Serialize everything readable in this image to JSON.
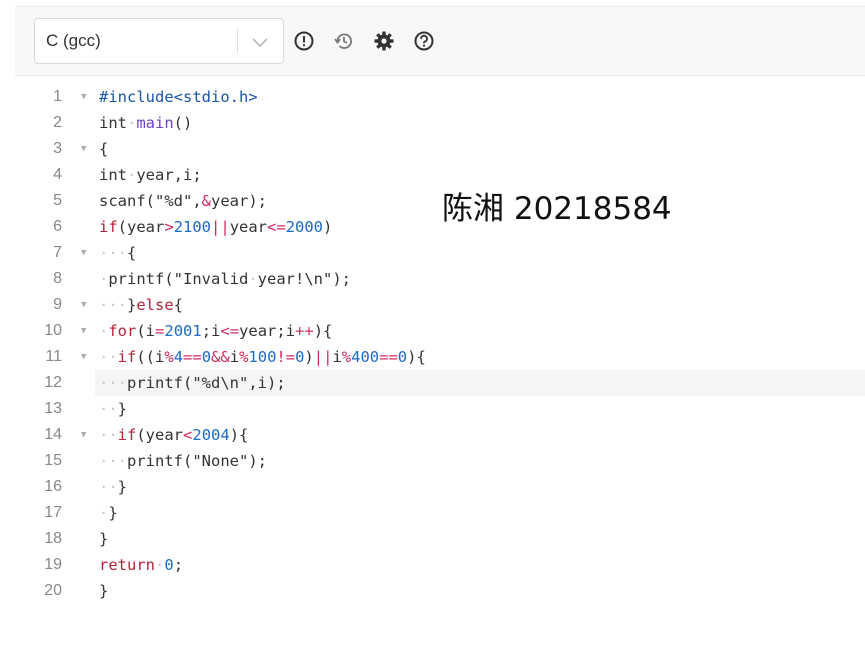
{
  "toolbar": {
    "language": "C (gcc)",
    "icons": [
      "alert-circle-icon",
      "history-icon",
      "gear-icon",
      "help-circle-icon"
    ]
  },
  "editor": {
    "line_numbers": [
      "1",
      "2",
      "3",
      "4",
      "5",
      "6",
      "7",
      "8",
      "9",
      "10",
      "11",
      "12",
      "13",
      "14",
      "15",
      "16",
      "17",
      "18",
      "19",
      "20"
    ],
    "active_line": 12
  },
  "overlay": {
    "text": "陈湘 20218584"
  }
}
